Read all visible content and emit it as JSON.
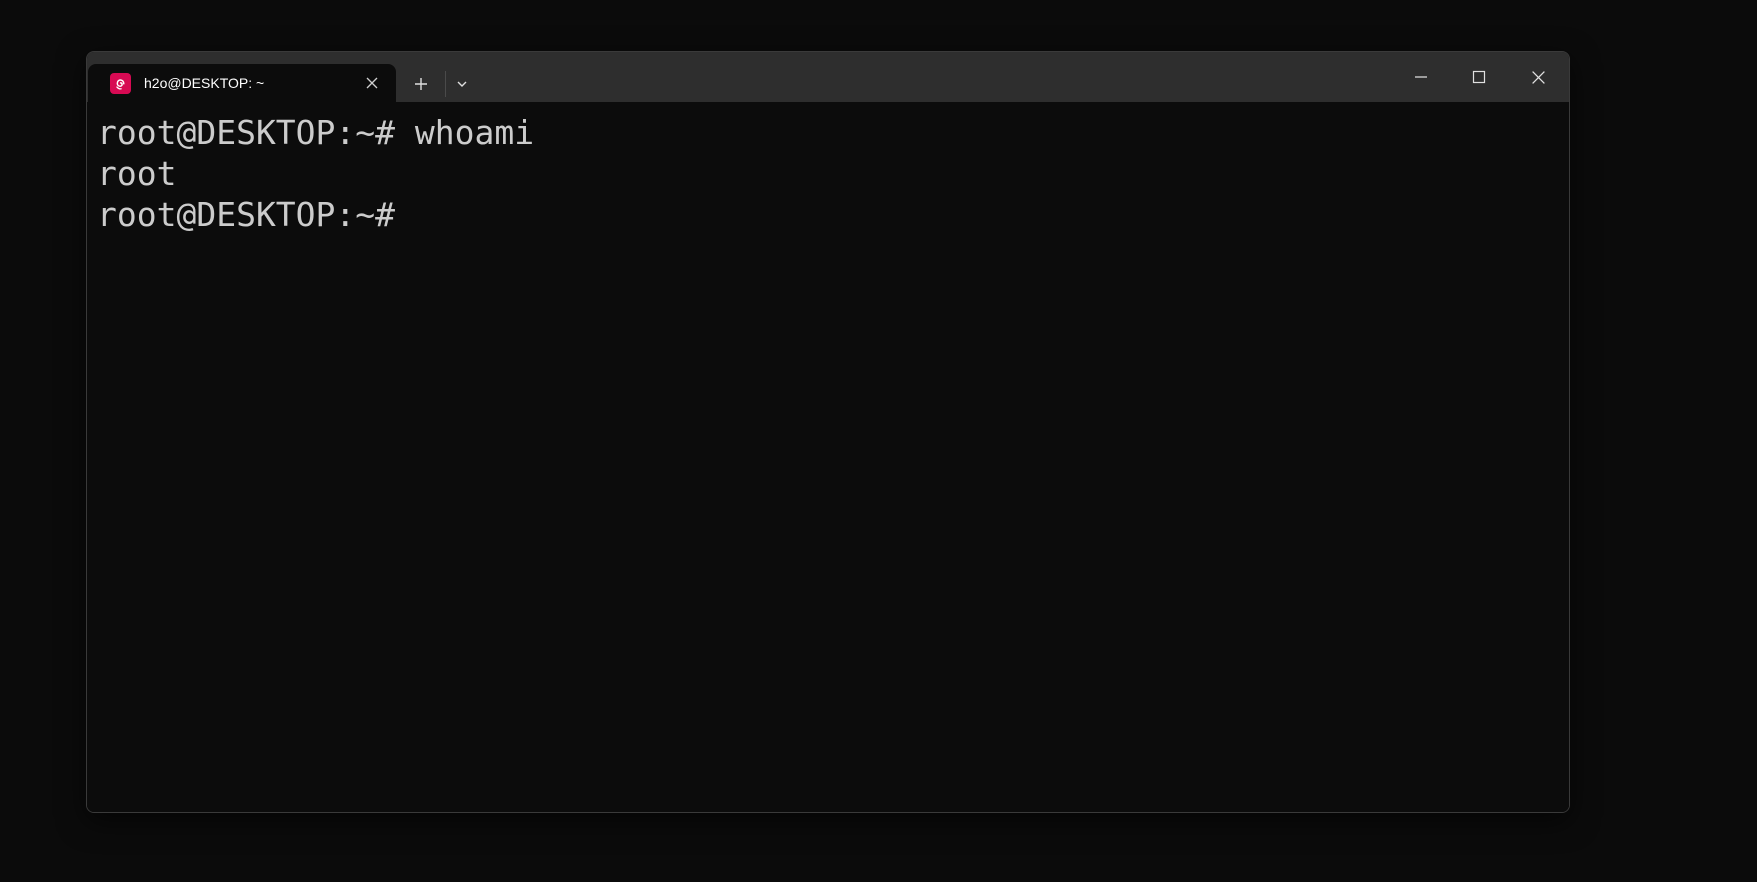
{
  "tab": {
    "title": "h2o@DESKTOP: ~",
    "icon": "debian-icon",
    "icon_color": "#d70a53"
  },
  "toolbar": {
    "new_tab_icon": "plus-icon",
    "dropdown_icon": "chevron-down-icon"
  },
  "window_controls": {
    "minimize_icon": "minimize-icon",
    "maximize_icon": "maximize-icon",
    "close_icon": "close-icon"
  },
  "terminal": {
    "lines": [
      "root@DESKTOP:~# whoami",
      "root",
      "root@DESKTOP:~#"
    ],
    "text_color": "#cccccc",
    "background": "#0c0c0c"
  }
}
